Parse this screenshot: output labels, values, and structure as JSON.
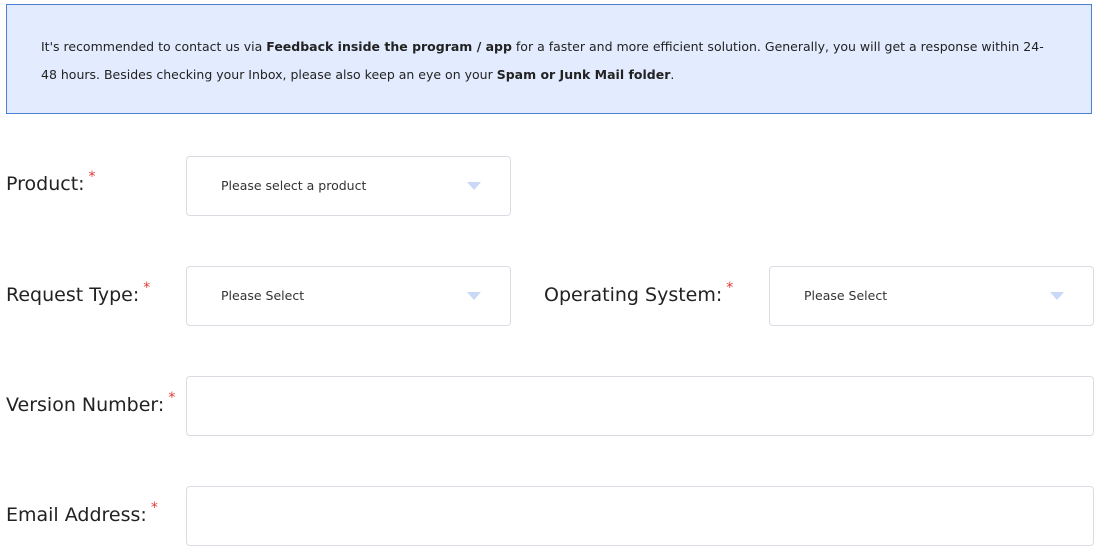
{
  "notice": {
    "part1": "It's recommended to contact us via ",
    "bold1": "Feedback inside the program / app",
    "part2": " for a faster and more efficient solution. Generally, you will get a response within 24-48 hours. Besides checking your Inbox, please also keep an eye on your ",
    "bold2": "Spam or Junk Mail folder",
    "part3": "."
  },
  "form": {
    "required_mark": "*",
    "product": {
      "label": "Product:",
      "value": "Please select a product"
    },
    "request_type": {
      "label": "Request Type:",
      "value": "Please Select"
    },
    "operating_system": {
      "label": "Operating System:",
      "value": "Please Select"
    },
    "version_number": {
      "label": "Version Number:",
      "value": ""
    },
    "email_address": {
      "label": "Email Address:",
      "value": ""
    }
  },
  "colors": {
    "notice_bg": "#e3ecff",
    "notice_border": "#4a7fd4",
    "required": "#e53935",
    "caret": "#c9d8f5",
    "field_border": "#d9dde3"
  },
  "icons": {
    "dropdown": "caret-down-icon"
  }
}
